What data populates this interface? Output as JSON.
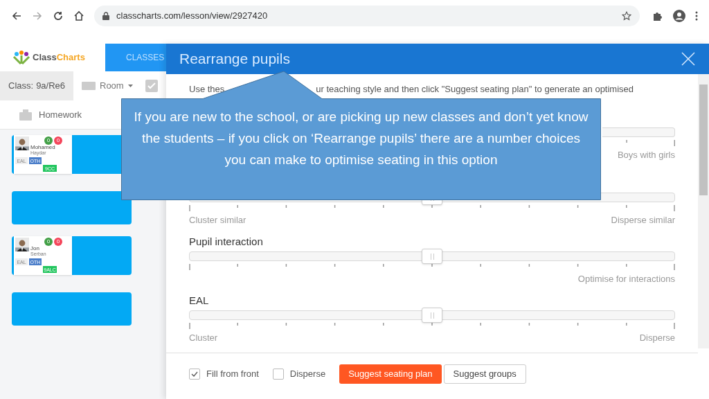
{
  "browser": {
    "url": "classcharts.com/lesson/view/2927420"
  },
  "app": {
    "logo_part1": "Class",
    "logo_part2": "Charts",
    "nav_tab": "CLASSES",
    "class_label": "Class:",
    "class_value": "9a/Re6",
    "room": "Room",
    "homework": "Homework"
  },
  "seats": [
    {
      "kind": "student",
      "first_name": "Mohamed",
      "last_name": "Haydar",
      "positive": "0",
      "negative": "0",
      "tags": [
        "EAL",
        "OTH"
      ],
      "group": "9CC"
    },
    {
      "kind": "empty"
    },
    {
      "kind": "student",
      "first_name": "Jon",
      "last_name": "Serban",
      "positive": "0",
      "negative": "0",
      "tags": [
        "EAL",
        "OTH"
      ],
      "group": "9ALC"
    },
    {
      "kind": "empty"
    }
  ],
  "modal": {
    "title": "Rearrange pupils",
    "intro_start": "Use thes",
    "intro_end": "ur teaching style and then click \"Suggest seating plan\" to generate an optimised",
    "sliders": [
      {
        "right_label": "Boys with girls"
      },
      {
        "left_label": "Cluster similar",
        "right_label": "Disperse similar",
        "level": 0.5
      },
      {
        "title": "Pupil interaction",
        "right_label": "Optimise for interactions",
        "level": 0.5
      },
      {
        "title": "EAL",
        "left_label": "Cluster",
        "right_label": "Disperse",
        "level": 0.5
      }
    ],
    "options": [
      {
        "label": "Fill from front",
        "checked": true
      },
      {
        "label": "Disperse",
        "checked": false
      }
    ],
    "primary_button": "Suggest seating plan",
    "secondary_button": "Suggest groups"
  },
  "callout": {
    "text": "If you are new to the school, or are picking up new classes and don’t yet know the students – if you click on ‘Rearrange pupils’ there are a number choices you can make to optimise seating in this option"
  }
}
